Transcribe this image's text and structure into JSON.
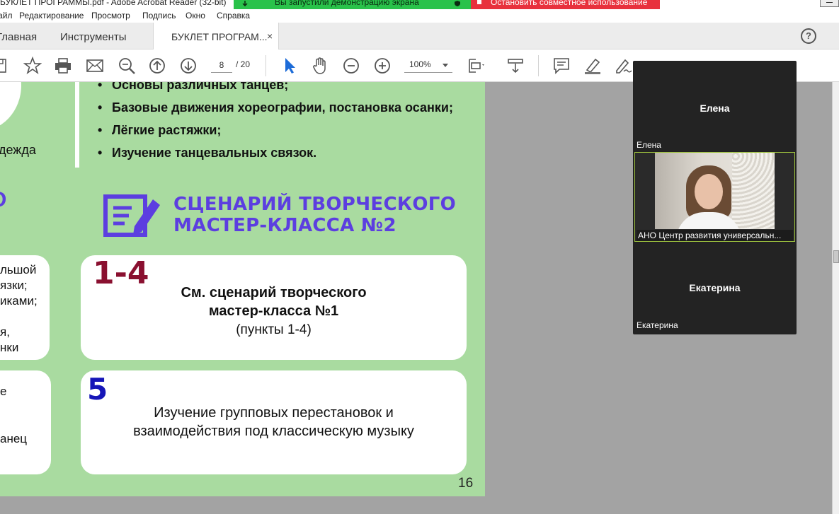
{
  "window": {
    "title": "БУКЛЕТ ПРОГРАММЫ.pdf - Adobe Acrobat Reader (32-bit)"
  },
  "share_banner": {
    "text": "Вы запустили демонстрацию экрана",
    "stop_text": "Остановить совместное использование"
  },
  "menu": {
    "items": [
      "Файл",
      "Редактирование",
      "Просмотр",
      "Подпись",
      "Окно",
      "Справка"
    ]
  },
  "tabs": {
    "home": "Главная",
    "tools": "Инструменты",
    "document": "БУКЛЕТ ПРОГРАМ...",
    "close": "×"
  },
  "toolbar": {
    "page_current": "8",
    "page_total": "/ 20",
    "zoom": "100%"
  },
  "icons": {
    "save": "save-icon",
    "bookmark": "star-icon",
    "print": "printer-icon",
    "email": "envelope-icon",
    "search": "zoom-search-icon",
    "prev": "arrow-up-circle-icon",
    "next": "arrow-down-circle-icon",
    "select": "cursor-icon",
    "hand": "hand-icon",
    "zoom_out": "minus-circle-icon",
    "zoom_in": "plus-circle-icon",
    "fit": "fit-page-icon",
    "scroll": "scroll-mode-icon",
    "comment": "comment-icon",
    "highlight": "highlighter-icon",
    "sign": "sign-icon",
    "help": "help-icon",
    "edit_doc": "edit-document-icon"
  },
  "document": {
    "left_text_1": "дежда",
    "bullets": [
      "Основы различных танцев;",
      "Базовые движения хореографии, постановка осанки;",
      "Лёгкие растяжки;",
      "Изучение танцевальных связок."
    ],
    "partial_o": "О",
    "heading_line1": "СЦЕНАРИЙ ТВОРЧЕСКОГО",
    "heading_line2": "МАСТЕР-КЛАССА №2",
    "left_card1_lines": [
      "льшой",
      "язки;",
      "иками;",
      "я,",
      "нки"
    ],
    "left_card2_lines": [
      "е",
      "анец"
    ],
    "card1": {
      "number": "1-4",
      "line1": "См. сценарий творческого",
      "line2": "мастер-класса №1",
      "line3": "(пункты 1-4)"
    },
    "card2": {
      "number": "5",
      "line1": "Изучение групповых перестановок и",
      "line2": "взаимодействия под классическую музыку"
    },
    "page_number": "16"
  },
  "participants": {
    "p1_center": "Елена",
    "p1_tag": "Елена",
    "video_tag": "АНО Центр развития универсальн...",
    "p3_center": "Екатерина",
    "p3_tag": "Екатерина"
  },
  "colors": {
    "page_bg": "#a9dba0",
    "heading": "#5c3ee0",
    "number_dark": "#8a1030",
    "number_blue": "#1616b8",
    "share_green": "#29c24a",
    "stop_red": "#e8313d",
    "video_border": "#9ec23e"
  }
}
